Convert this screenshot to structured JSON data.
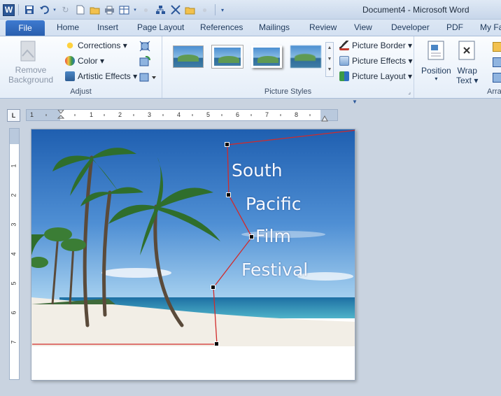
{
  "window": {
    "title": "Document4  -  Microsoft Word"
  },
  "qat": {
    "app_icon": "W"
  },
  "tabs": [
    {
      "label": "File"
    },
    {
      "label": "Home"
    },
    {
      "label": "Insert"
    },
    {
      "label": "Page Layout"
    },
    {
      "label": "References"
    },
    {
      "label": "Mailings"
    },
    {
      "label": "Review"
    },
    {
      "label": "View"
    },
    {
      "label": "Developer"
    },
    {
      "label": "PDF"
    },
    {
      "label": "My Fa"
    }
  ],
  "ribbon": {
    "adjust": {
      "remove_background_line1": "Remove",
      "remove_background_line2": "Background",
      "corrections": "Corrections ▾",
      "color": "Color ▾",
      "artistic_effects": "Artistic Effects ▾",
      "label": "Adjust"
    },
    "picture_styles": {
      "label": "Picture Styles",
      "border": "Picture Border ▾",
      "effects": "Picture Effects ▾",
      "layout": "Picture Layout ▾"
    },
    "arrange": {
      "position": "Position",
      "wrap_text_line1": "Wrap",
      "wrap_text_line2": "Text ▾",
      "label": "Arra"
    }
  },
  "ruler": {
    "h_ticks": [
      "1",
      "1",
      "2",
      "3",
      "4",
      "5",
      "6",
      "7",
      "8",
      "9"
    ],
    "v_ticks": [
      "1",
      "1",
      "2",
      "3",
      "4",
      "5",
      "6",
      "7"
    ],
    "tab_selector": "L"
  },
  "document": {
    "lines": [
      "South",
      "Pacific",
      "Film",
      "Festival"
    ]
  },
  "colors": {
    "file_tab": "#2a5fae",
    "crop_outline": "#d12b2b"
  }
}
